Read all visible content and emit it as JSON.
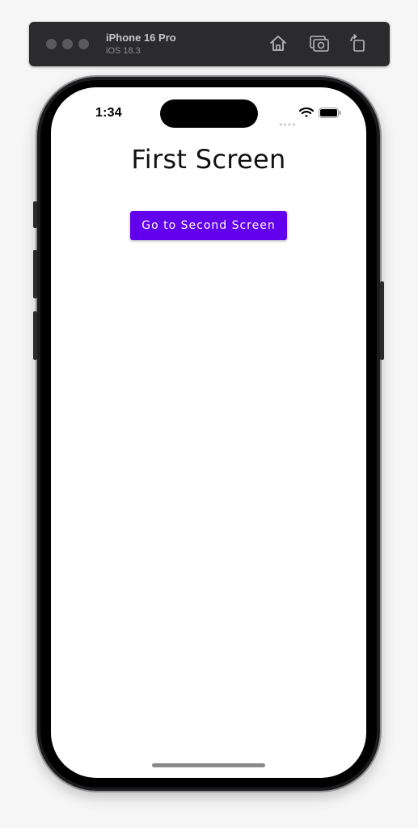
{
  "simulator": {
    "device_name": "iPhone 16 Pro",
    "os_version": "iOS 18.3",
    "icons": [
      "home-icon",
      "screenshot-icon",
      "rotate-icon"
    ]
  },
  "status_bar": {
    "time": "1:34",
    "icons": [
      "cellular-signal-icon",
      "wifi-icon",
      "battery-icon"
    ]
  },
  "screen": {
    "title": "First Screen",
    "button_label": "Go to Second Screen"
  },
  "colors": {
    "button_bg": "#6200ee",
    "button_text": "#ffffff",
    "screen_bg": "#ffffff",
    "toolbar_bg": "#2b2b2d"
  }
}
